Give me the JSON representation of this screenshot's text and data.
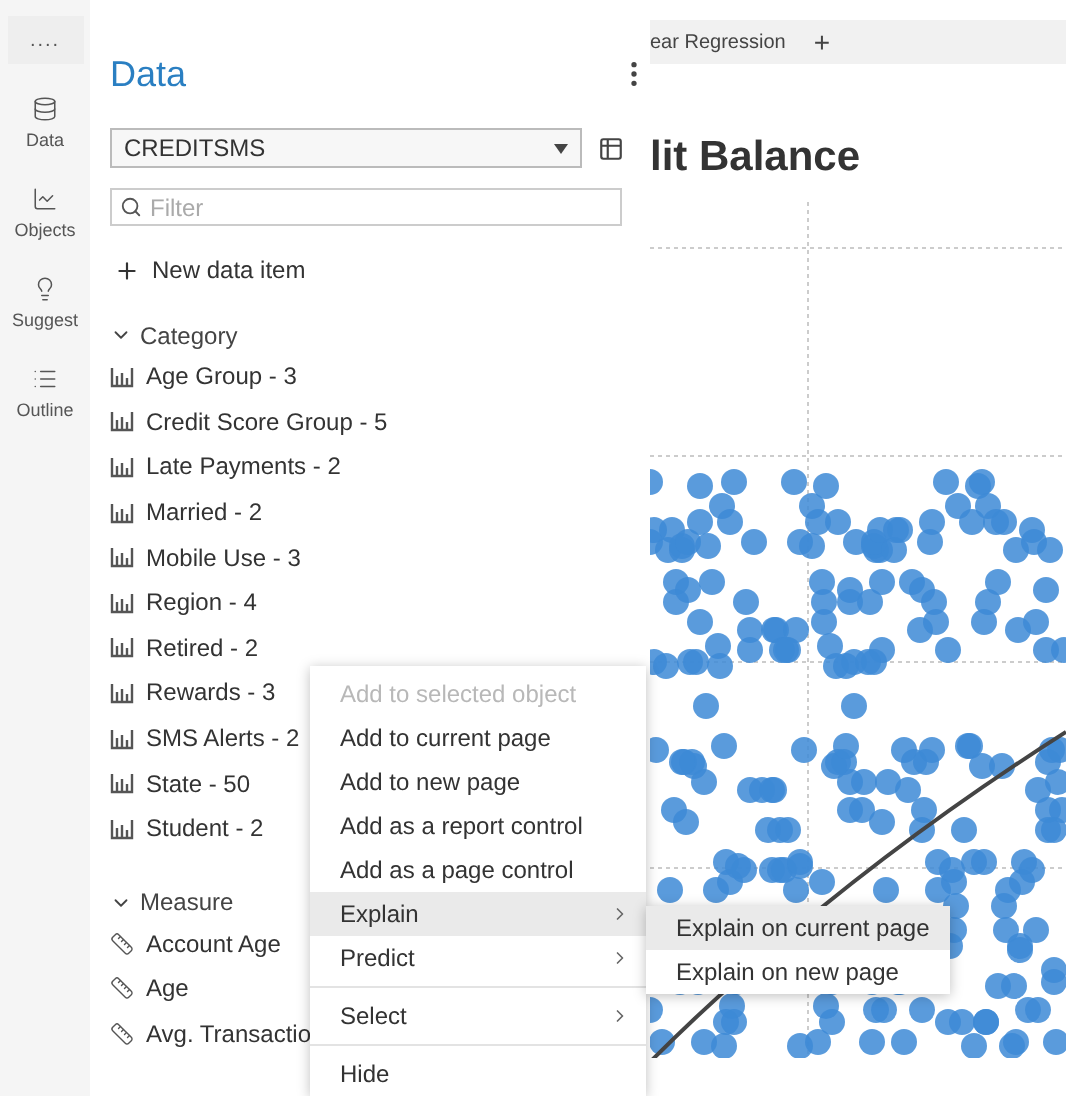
{
  "rail": {
    "more": "....",
    "items": [
      {
        "label": "Data"
      },
      {
        "label": "Objects"
      },
      {
        "label": "Suggest"
      },
      {
        "label": "Outline"
      }
    ]
  },
  "data_panel": {
    "title": "Data",
    "source": {
      "value": "CREDITSMS"
    },
    "filter": {
      "placeholder": "Filter"
    },
    "new_item": "New data item",
    "sections": [
      {
        "title": "Category",
        "kind": "category",
        "expanded": true,
        "items": [
          "Age Group - 3",
          "Credit Score Group - 5",
          "Late Payments - 2",
          "Married - 2",
          "Mobile Use - 3",
          "Region - 4",
          "Retired - 2",
          "Rewards - 3",
          "SMS Alerts - 2",
          "State - 50",
          "Student - 2"
        ]
      },
      {
        "title": "Measure",
        "kind": "measure",
        "expanded": true,
        "items": [
          "Account Age",
          "Age",
          "Avg. Transactio"
        ]
      }
    ]
  },
  "canvas": {
    "tabs": [
      {
        "label": "ear Regression"
      },
      {
        "label": "+"
      }
    ],
    "title": "lit Balance"
  },
  "context_menu": {
    "groups": [
      [
        {
          "label": "Add to selected object",
          "disabled": true,
          "selected": false,
          "submenu": false
        },
        {
          "label": "Add to current page",
          "disabled": false,
          "selected": false,
          "submenu": false
        },
        {
          "label": "Add to new page",
          "disabled": false,
          "selected": false,
          "submenu": false
        },
        {
          "label": "Add as a report control",
          "disabled": false,
          "selected": false,
          "submenu": false
        },
        {
          "label": "Add as a page control",
          "disabled": false,
          "selected": false,
          "submenu": false
        },
        {
          "label": "Explain",
          "disabled": false,
          "selected": true,
          "submenu": true
        },
        {
          "label": "Predict",
          "disabled": false,
          "selected": false,
          "submenu": true
        }
      ],
      [
        {
          "label": "Select",
          "disabled": false,
          "selected": false,
          "submenu": true
        }
      ],
      [
        {
          "label": "Hide",
          "disabled": false,
          "selected": false,
          "submenu": false
        }
      ]
    ]
  },
  "submenu": {
    "items": [
      {
        "label": "Explain on current page",
        "selected": true
      },
      {
        "label": "Explain on new page",
        "selected": false
      }
    ]
  }
}
